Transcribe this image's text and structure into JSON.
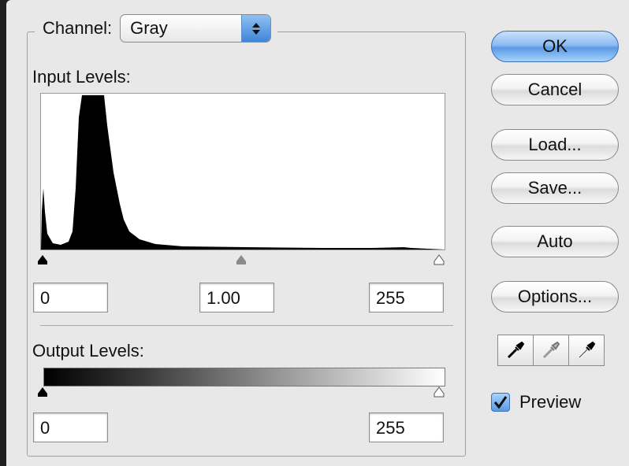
{
  "dialog": {
    "channel_label": "Channel:",
    "channel_value": "Gray",
    "input_levels_label": "Input Levels:",
    "input_black": "0",
    "input_gamma": "1.00",
    "input_white": "255",
    "output_levels_label": "Output Levels:",
    "output_black": "0",
    "output_white": "255"
  },
  "buttons": {
    "ok": "OK",
    "cancel": "Cancel",
    "load": "Load...",
    "save": "Save...",
    "auto": "Auto",
    "options": "Options..."
  },
  "preview": {
    "label": "Preview",
    "checked": true
  },
  "eyedroppers": [
    "black-point-eyedropper-icon",
    "gray-point-eyedropper-icon",
    "white-point-eyedropper-icon"
  ],
  "colors": {
    "default_button": "#6fa8ec",
    "histogram_fill": "#000000",
    "dialog_bg": "#e8e8e8"
  }
}
